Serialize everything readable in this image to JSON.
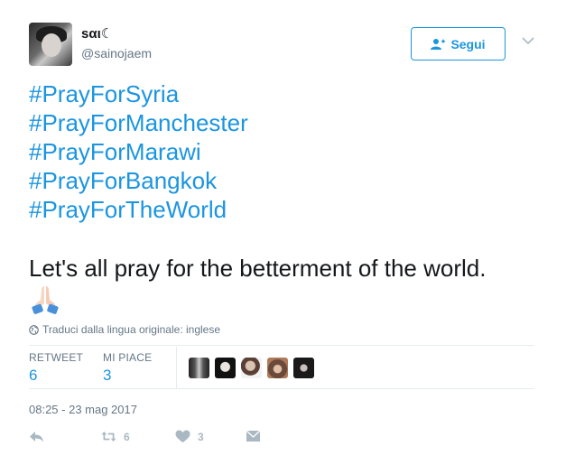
{
  "author": {
    "display_name": "sαι☾",
    "handle": "@sainojaem"
  },
  "follow_button": {
    "label": "Segui"
  },
  "hashtags": [
    "#PrayForSyria",
    "#PrayForManchester",
    "#PrayForMarawi",
    "#PrayForBangkok",
    "#PrayForTheWorld"
  ],
  "text": "Let's all pray for the betterment of the world.",
  "translate_label": "Traduci dalla lingua originale: inglese",
  "stats": {
    "retweet_label": "RETWEET",
    "retweet_count": "6",
    "likes_label": "MI PIACE",
    "likes_count": "3"
  },
  "timestamp": "08:25 - 23 mag 2017",
  "actions": {
    "retweet_count": "6",
    "like_count": "3"
  },
  "colors": {
    "accent": "#1b95e0",
    "muted": "#657786",
    "action_gray": "#aab8c2"
  }
}
